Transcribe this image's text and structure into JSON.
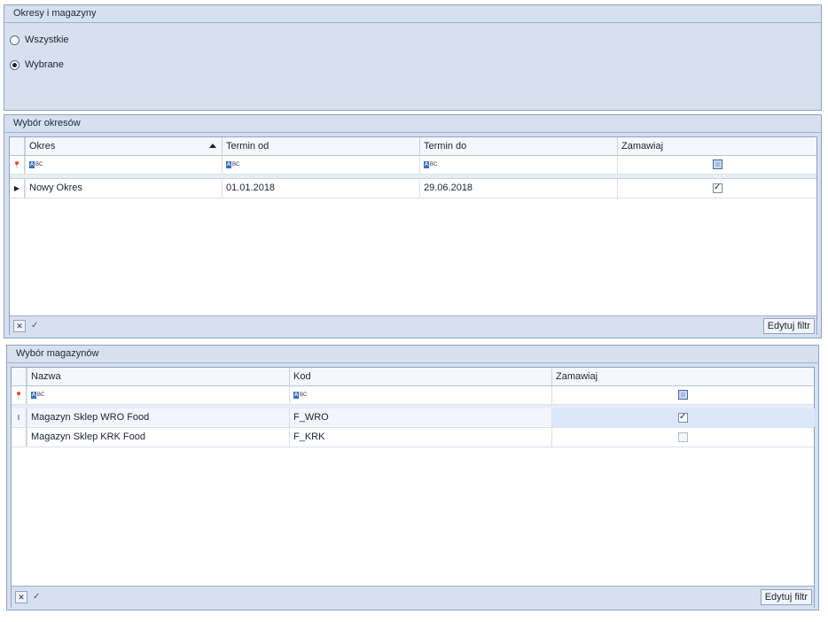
{
  "periods_section": {
    "title": "Okresy i magazyny",
    "options": [
      {
        "label": "Wszystkie",
        "selected": false
      },
      {
        "label": "Wybrane",
        "selected": true
      }
    ]
  },
  "periods_grid": {
    "title": "Wybór okresów",
    "columns": [
      "Okres",
      "Termin od",
      "Termin do",
      "Zamawiaj"
    ],
    "sorted_column": "Okres",
    "filter_placeholder": "ABC",
    "rows": [
      {
        "okres": "Nowy Okres",
        "termin_od": "01.01.2018",
        "termin_do": "29.06.2018",
        "zamawiaj": true
      }
    ],
    "edit_filter_label": "Edytuj filtr"
  },
  "warehouses_grid": {
    "title": "Wybór magazynów",
    "columns": [
      "Nazwa",
      "Kod",
      "Zamawiaj"
    ],
    "filter_placeholder": "ABC",
    "rows": [
      {
        "nazwa": "Magazyn Sklep WRO Food",
        "kod": "F_WRO",
        "zamawiaj": true
      },
      {
        "nazwa": "Magazyn Sklep KRK Food",
        "kod": "F_KRK",
        "zamawiaj": false
      }
    ],
    "edit_filter_label": "Edytuj filtr"
  }
}
